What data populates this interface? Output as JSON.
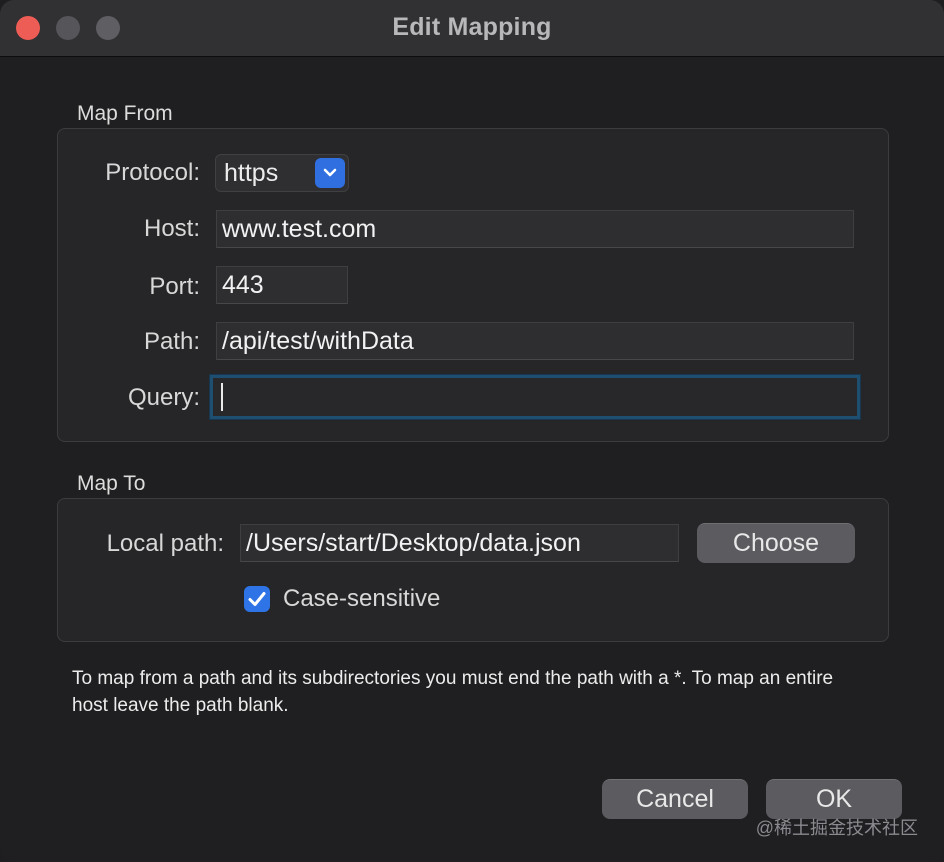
{
  "window": {
    "title": "Edit Mapping"
  },
  "map_from": {
    "section_label": "Map From",
    "protocol_label": "Protocol:",
    "protocol_value": "https",
    "host_label": "Host:",
    "host_value": "www.test.com",
    "port_label": "Port:",
    "port_value": "443",
    "path_label": "Path:",
    "path_value": "/api/test/withData",
    "query_label": "Query:",
    "query_value": ""
  },
  "map_to": {
    "section_label": "Map To",
    "local_path_label": "Local path:",
    "local_path_value": "/Users/start/Desktop/data.json",
    "choose_label": "Choose",
    "case_sensitive_label": "Case-sensitive",
    "case_sensitive_checked": true
  },
  "note": "To map from a path and its subdirectories you must end the path with a *. To map an entire host leave the path blank.",
  "buttons": {
    "cancel_label": "Cancel",
    "ok_label": "OK"
  },
  "watermark": "@稀土掘金技术社区",
  "colors": {
    "accent": "#2f74e6",
    "focus_ring": "#1f4f70",
    "close": "#ee5d55"
  }
}
